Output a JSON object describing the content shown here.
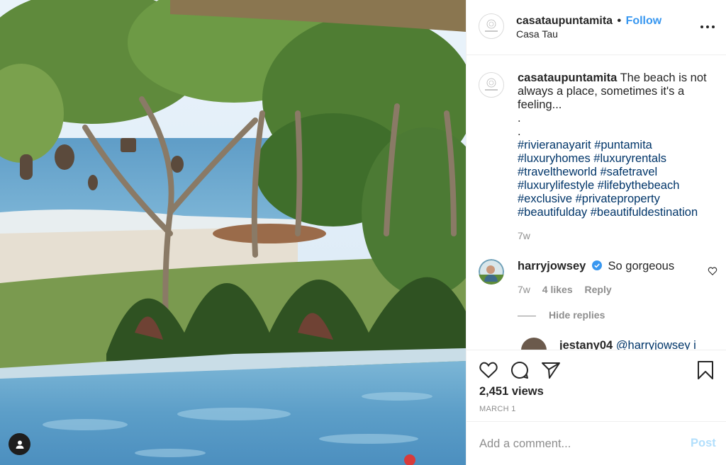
{
  "header": {
    "username": "casataupuntamita",
    "separator": "•",
    "follow_label": "Follow",
    "location": "Casa Tau",
    "more_icon": "more-options-icon"
  },
  "caption": {
    "username": "casataupuntamita",
    "text": "The beach is not always a place, sometimes it's a feeling...",
    "dot1": ".",
    "dot2": ".",
    "hashtags": "#rivieranayarit #puntamita #luxuryhomes #luxuryrentals #traveltheworld #safetravel #luxurylifestyle #lifebythebeach #exclusive #privateproperty #beautifulday #beautifuldestination",
    "time": "7w"
  },
  "comments": [
    {
      "username": "harryjowsey",
      "verified": true,
      "text": "So gorgeous",
      "time": "7w",
      "likes": "4 likes",
      "reply_label": "Reply",
      "hide_replies_label": "Hide replies"
    }
  ],
  "reply": {
    "username": "jestany04",
    "text": "@harryjowsey i"
  },
  "actions": {
    "views": "2,451 views",
    "date": "MARCH 1"
  },
  "add_comment": {
    "placeholder": "Add a comment...",
    "post_label": "Post"
  },
  "colors": {
    "link_blue": "#3897f0",
    "hashtag_blue": "#003569",
    "muted": "#8e8e8e",
    "post_disabled": "#b2dffc",
    "verified_blue": "#3897f0"
  }
}
